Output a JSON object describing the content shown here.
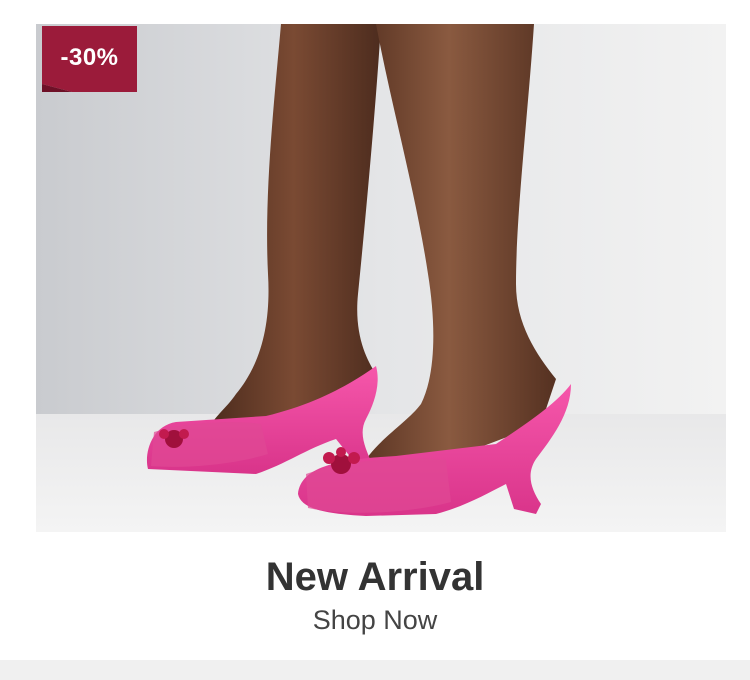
{
  "product": {
    "discount_badge": "-30%",
    "title": "New Arrival",
    "cta_label": "Shop Now"
  },
  "colors": {
    "badge": "#9b1b3a",
    "title_text": "#333333",
    "cta_text": "#444444",
    "shoe": "#f0449a"
  },
  "icons": [
    "discount-ribbon"
  ]
}
